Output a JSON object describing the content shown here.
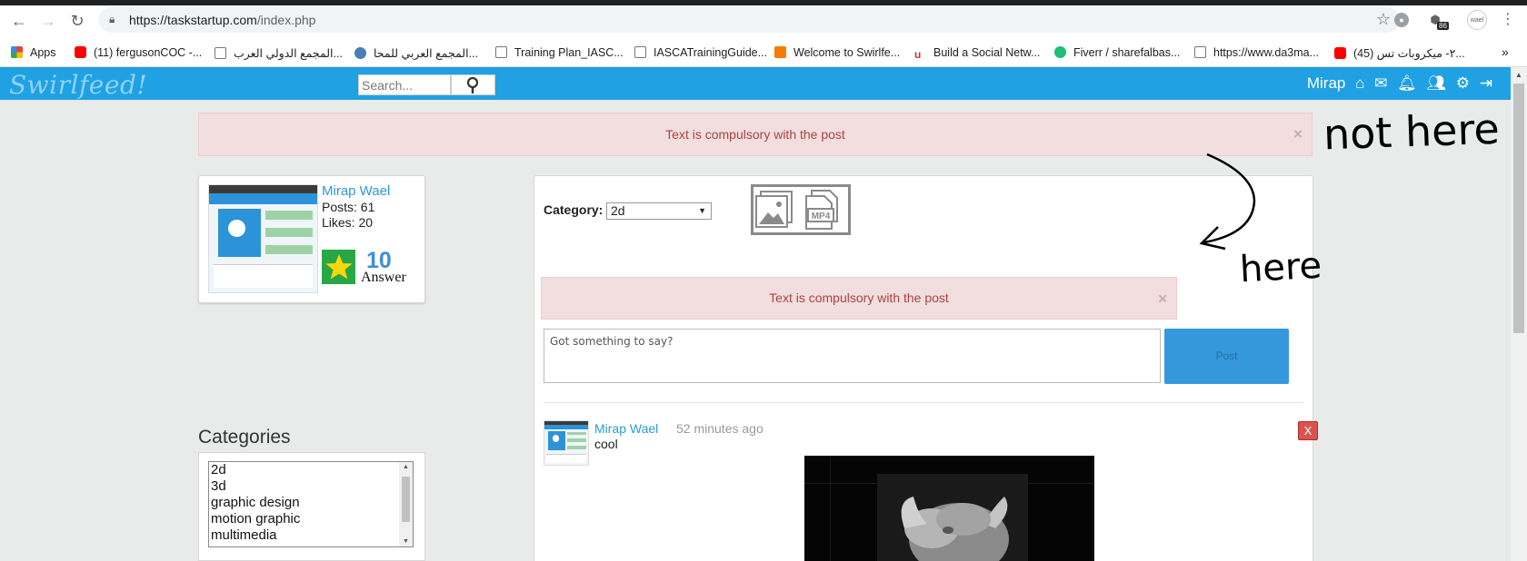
{
  "browser": {
    "url_host": "https://taskstartup.com",
    "url_path": "/index.php",
    "bookmarks": [
      {
        "label": "Apps",
        "color": "#e53935"
      },
      {
        "label": "(11) fergusonCOC -...",
        "color": "#ff0000"
      },
      {
        "label": "المجمع الدولي العرب...",
        "color": "#ffffff"
      },
      {
        "label": "المجمع العربي للمحا...",
        "color": "#4a7db5"
      },
      {
        "label": "Training Plan_IASC...",
        "color": "#ffffff"
      },
      {
        "label": "IASCATrainingGuide...",
        "color": "#ffffff"
      },
      {
        "label": "Welcome to Swirlfe...",
        "color": "#f57c00"
      },
      {
        "label": "Build a Social Netw...",
        "color": "#d32f2f"
      },
      {
        "label": "Fiverr / sharefalbas...",
        "color": "#1dbf73"
      },
      {
        "label": "https://www.da3ma...",
        "color": "#ffffff"
      },
      {
        "label": "(45) ٢- ميكروبات تس...",
        "color": "#ff0000"
      }
    ],
    "more_label": "»",
    "ext_badge": "86"
  },
  "app": {
    "logo": "Swirlfeed!",
    "search_placeholder": "Search...",
    "username": "Mirap",
    "brand_color": "#20a1e3"
  },
  "alerts": {
    "top": "Text is compulsory with the post",
    "inline": "Text is compulsory with the post",
    "close_glyph": "×"
  },
  "profile": {
    "name": "Mirap Wael",
    "posts": "Posts: 61",
    "likes": "Likes: 20",
    "score": "10",
    "score_label": "Answer"
  },
  "categories": {
    "title": "Categories",
    "options": [
      "2d",
      "3d",
      "graphic design",
      "motion graphic",
      "multimedia"
    ]
  },
  "composer": {
    "category_label": "Category:",
    "category_value": "2d",
    "placeholder": "Got something to say?",
    "post_button": "Post"
  },
  "post": {
    "author": "Mirap Wael",
    "time": "52 minutes ago",
    "text": "cool",
    "delete_label": "X"
  },
  "annotations": {
    "not_here": "not here",
    "here": "here"
  }
}
